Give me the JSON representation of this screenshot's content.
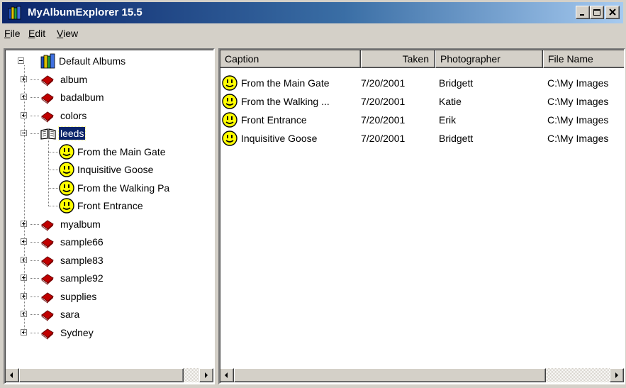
{
  "window": {
    "title": "MyAlbumExplorer 15.5",
    "icon": "album-library-icon"
  },
  "menu": [
    {
      "label": "File",
      "mnemonic": "F",
      "rest": "ile"
    },
    {
      "label": "Edit",
      "mnemonic": "E",
      "rest": "dit"
    },
    {
      "label": "View",
      "mnemonic": "V",
      "rest": "iew"
    }
  ],
  "tree": {
    "root": {
      "label": "Default Albums",
      "icon": "album-library-icon",
      "expanded": true
    },
    "albums": [
      {
        "label": "album",
        "icon": "closed-book-icon",
        "expanded": false
      },
      {
        "label": "badalbum",
        "icon": "closed-book-icon",
        "expanded": false
      },
      {
        "label": "colors",
        "icon": "closed-book-icon",
        "expanded": false
      },
      {
        "label": "leeds",
        "icon": "open-book-icon",
        "expanded": true,
        "selected": true,
        "children": [
          {
            "label": "From the Main Gate",
            "icon": "smiley-icon"
          },
          {
            "label": "Inquisitive Goose",
            "icon": "smiley-icon"
          },
          {
            "label": "From the Walking Pa",
            "icon": "smiley-icon"
          },
          {
            "label": "Front Entrance",
            "icon": "smiley-icon"
          }
        ]
      },
      {
        "label": "myalbum",
        "icon": "closed-book-icon",
        "expanded": false
      },
      {
        "label": "sample66",
        "icon": "closed-book-icon",
        "expanded": false
      },
      {
        "label": "sample83",
        "icon": "closed-book-icon",
        "expanded": false
      },
      {
        "label": "sample92",
        "icon": "closed-book-icon",
        "expanded": false
      },
      {
        "label": "supplies",
        "icon": "closed-book-icon",
        "expanded": false
      },
      {
        "label": "sara",
        "icon": "closed-book-icon",
        "expanded": false
      },
      {
        "label": "Sydney",
        "icon": "closed-book-icon",
        "expanded": false
      }
    ]
  },
  "list": {
    "columns": [
      "Caption",
      "Taken",
      "Photographer",
      "File Name"
    ],
    "rows": [
      {
        "caption": "From the Main Gate",
        "taken": "7/20/2001",
        "photographer": "Bridgett",
        "file": "C:\\My Images"
      },
      {
        "caption": "From the Walking ...",
        "taken": "7/20/2001",
        "photographer": "Katie",
        "file": "C:\\My Images"
      },
      {
        "caption": "Front Entrance",
        "taken": "7/20/2001",
        "photographer": "Erik",
        "file": "C:\\My Images"
      },
      {
        "caption": "Inquisitive Goose",
        "taken": "7/20/2001",
        "photographer": "Bridgett",
        "file": "C:\\My Images"
      }
    ]
  },
  "colors": {
    "title_gradient_start": "#0a246a",
    "title_gradient_end": "#a6caf0",
    "selection": "#0a246a",
    "chrome": "#d4d0c8",
    "book_red": "#c00000",
    "smiley_yellow": "#ffff00"
  }
}
